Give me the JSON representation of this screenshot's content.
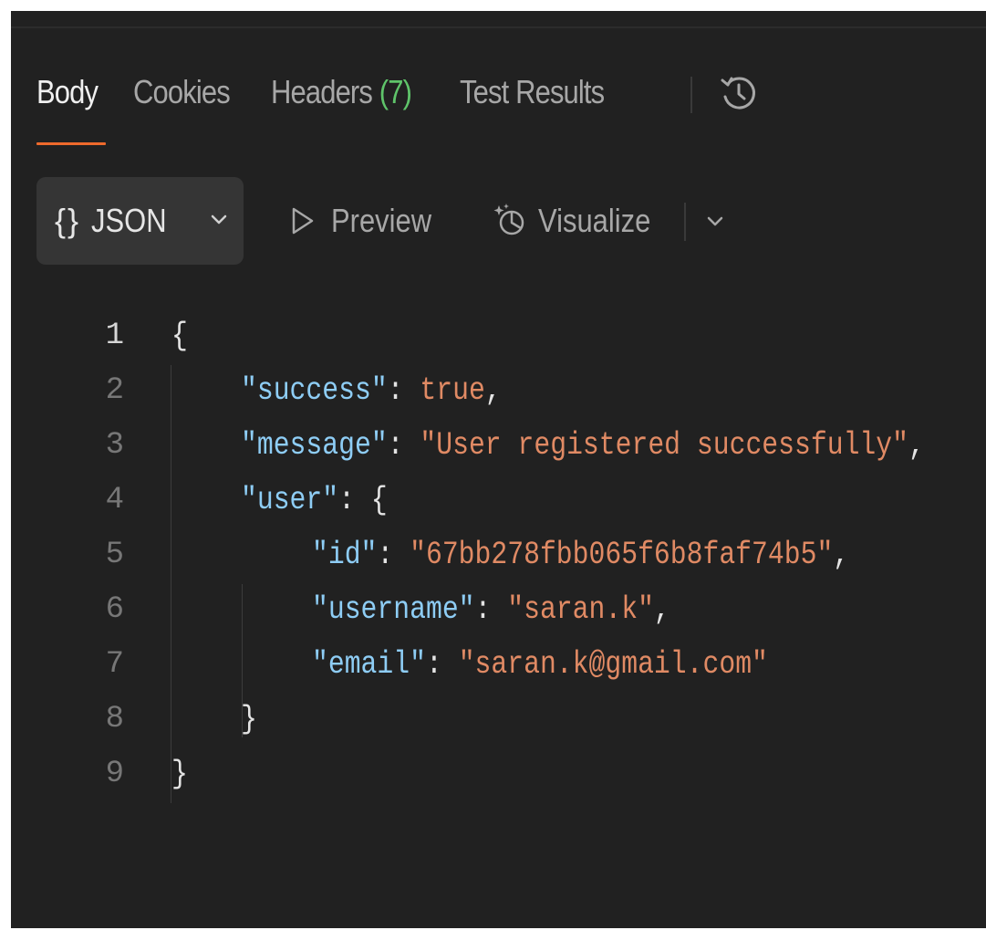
{
  "tabs": {
    "body": "Body",
    "cookies": "Cookies",
    "headers": "Headers",
    "headers_count": "(7)",
    "test_results": "Test Results",
    "history_icon": "history-icon"
  },
  "toolbar": {
    "format_braces": "{}",
    "format_label": "JSON",
    "preview_label": "Preview",
    "visualize_label": "Visualize"
  },
  "colors": {
    "background": "#212121",
    "accent_underline": "#ee6a2c",
    "count_green": "#5fc46a",
    "json_key": "#8ecdf5",
    "json_string": "#e08a64"
  },
  "response": {
    "line_numbers": [
      "1",
      "2",
      "3",
      "4",
      "5",
      "6",
      "7",
      "8",
      "9"
    ],
    "open_brace": "{",
    "close_brace": "}",
    "success_key": "\"success\"",
    "success_value": "true",
    "message_key": "\"message\"",
    "message_value": "\"User registered successfully\"",
    "user_key": "\"user\"",
    "id_key": "\"id\"",
    "id_value": "\"67bb278fbb065f6b8faf74b5\"",
    "username_key": "\"username\"",
    "username_value": "\"saran.k\"",
    "email_key": "\"email\"",
    "email_value": "\"saran.k@gmail.com\""
  }
}
